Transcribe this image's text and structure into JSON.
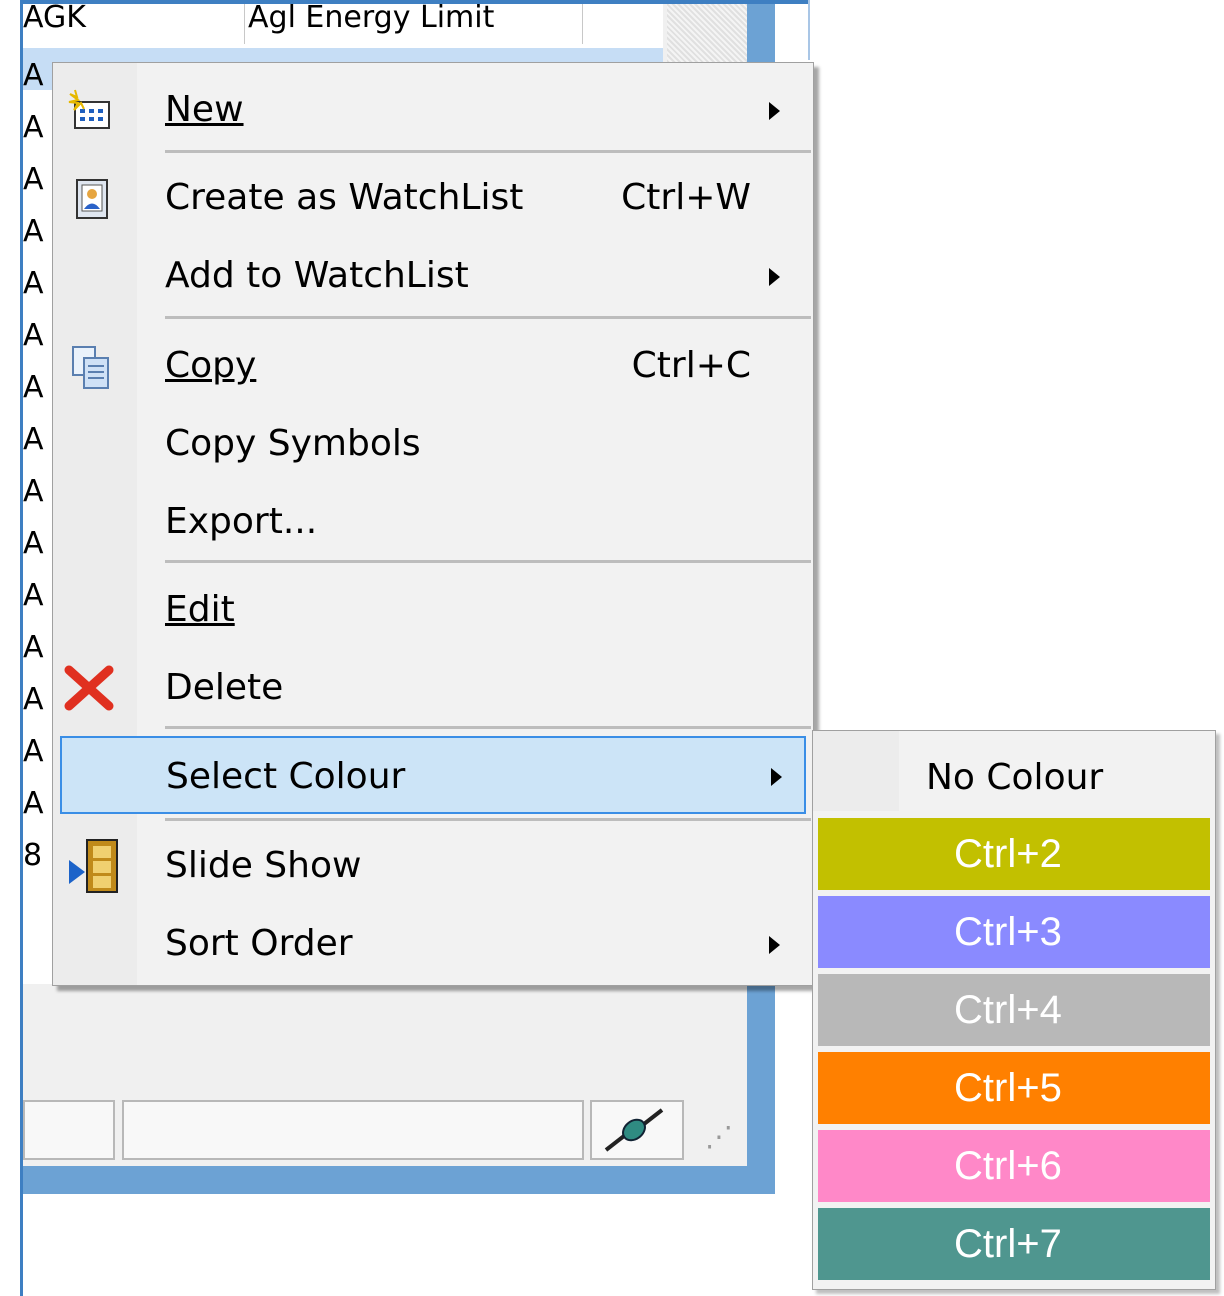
{
  "list": {
    "first_row_symbol": "AGK",
    "first_row_name": "Agl Energy Limit",
    "row_symbols": [
      "A",
      "A",
      "A",
      "A",
      "A",
      "A",
      "A",
      "A",
      "A",
      "A",
      "A",
      "A",
      "A",
      "A",
      "A",
      "8"
    ]
  },
  "menu": {
    "items": [
      {
        "label": "New",
        "has_submenu": true,
        "icon": "new-list-icon"
      },
      {
        "label": "Create as WatchList",
        "shortcut": "Ctrl+W",
        "icon": "watchlist-icon"
      },
      {
        "label": "Add to WatchList",
        "has_submenu": true
      },
      {
        "label": "Copy",
        "shortcut": "Ctrl+C",
        "icon": "copy-icon"
      },
      {
        "label": "Copy Symbols"
      },
      {
        "label": "Export..."
      },
      {
        "label": "Edit"
      },
      {
        "label": "Delete",
        "icon": "delete-icon"
      },
      {
        "label": "Select Colour",
        "has_submenu": true,
        "highlighted": true
      },
      {
        "label": "Slide Show",
        "icon": "slideshow-icon"
      },
      {
        "label": "Sort Order",
        "has_submenu": true
      }
    ]
  },
  "colour_submenu": {
    "no_colour_label": "No Colour",
    "swatches": [
      {
        "label": "Ctrl+2",
        "color": "#c2c000"
      },
      {
        "label": "Ctrl+3",
        "color": "#8a8aff"
      },
      {
        "label": "Ctrl+4",
        "color": "#b8b8b8"
      },
      {
        "label": "Ctrl+5",
        "color": "#ff8000"
      },
      {
        "label": "Ctrl+6",
        "color": "#ff88c8"
      },
      {
        "label": "Ctrl+7",
        "color": "#4f968f"
      }
    ]
  },
  "colors": {
    "window_border": "#3e7fc2",
    "menu_highlight": "#cce4f7",
    "delete_icon": "#e03020"
  }
}
